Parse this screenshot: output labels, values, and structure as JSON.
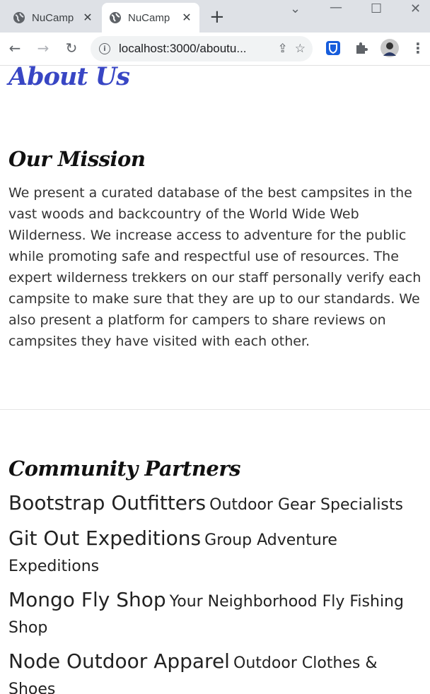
{
  "browser": {
    "tabs": [
      {
        "title": "NuCamp",
        "active": false
      },
      {
        "title": "NuCamp",
        "active": true
      }
    ],
    "new_tab_icon": "plus-icon",
    "window_controls": [
      "minimize",
      "maximize",
      "close"
    ],
    "address": "localhost:3000/aboutu...",
    "toolbar_icons": [
      "back-arrow",
      "forward-arrow",
      "reload",
      "site-info",
      "share",
      "bookmark-star",
      "bitwarden-extension",
      "extensions-puzzle",
      "profile-avatar",
      "kebab-menu"
    ]
  },
  "page": {
    "title": "About Us",
    "title_color": "#3846c4",
    "mission": {
      "heading": "Our Mission",
      "text": "We present a curated database of the best campsites in the vast woods and backcountry of the World Wide Web Wilderness. We increase access to adventure for the public while promoting safe and respectful use of resources. The expert wilderness trekkers on our staff personally verify each campsite to make sure that they are up to our standards. We also present a platform for campers to share reviews on campsites they have visited with each other."
    },
    "partners": {
      "heading": "Community Partners",
      "items": [
        {
          "name": "Bootstrap Outfitters",
          "tagline": "Outdoor Gear Specialists"
        },
        {
          "name": "Git Out Expeditions",
          "tagline": "Group Adventure Expeditions"
        },
        {
          "name": "Mongo Fly Shop",
          "tagline": "Your Neighborhood Fly Fishing Shop"
        },
        {
          "name": "Node Outdoor Apparel",
          "tagline": "Outdoor Clothes & Shoes"
        }
      ]
    }
  }
}
